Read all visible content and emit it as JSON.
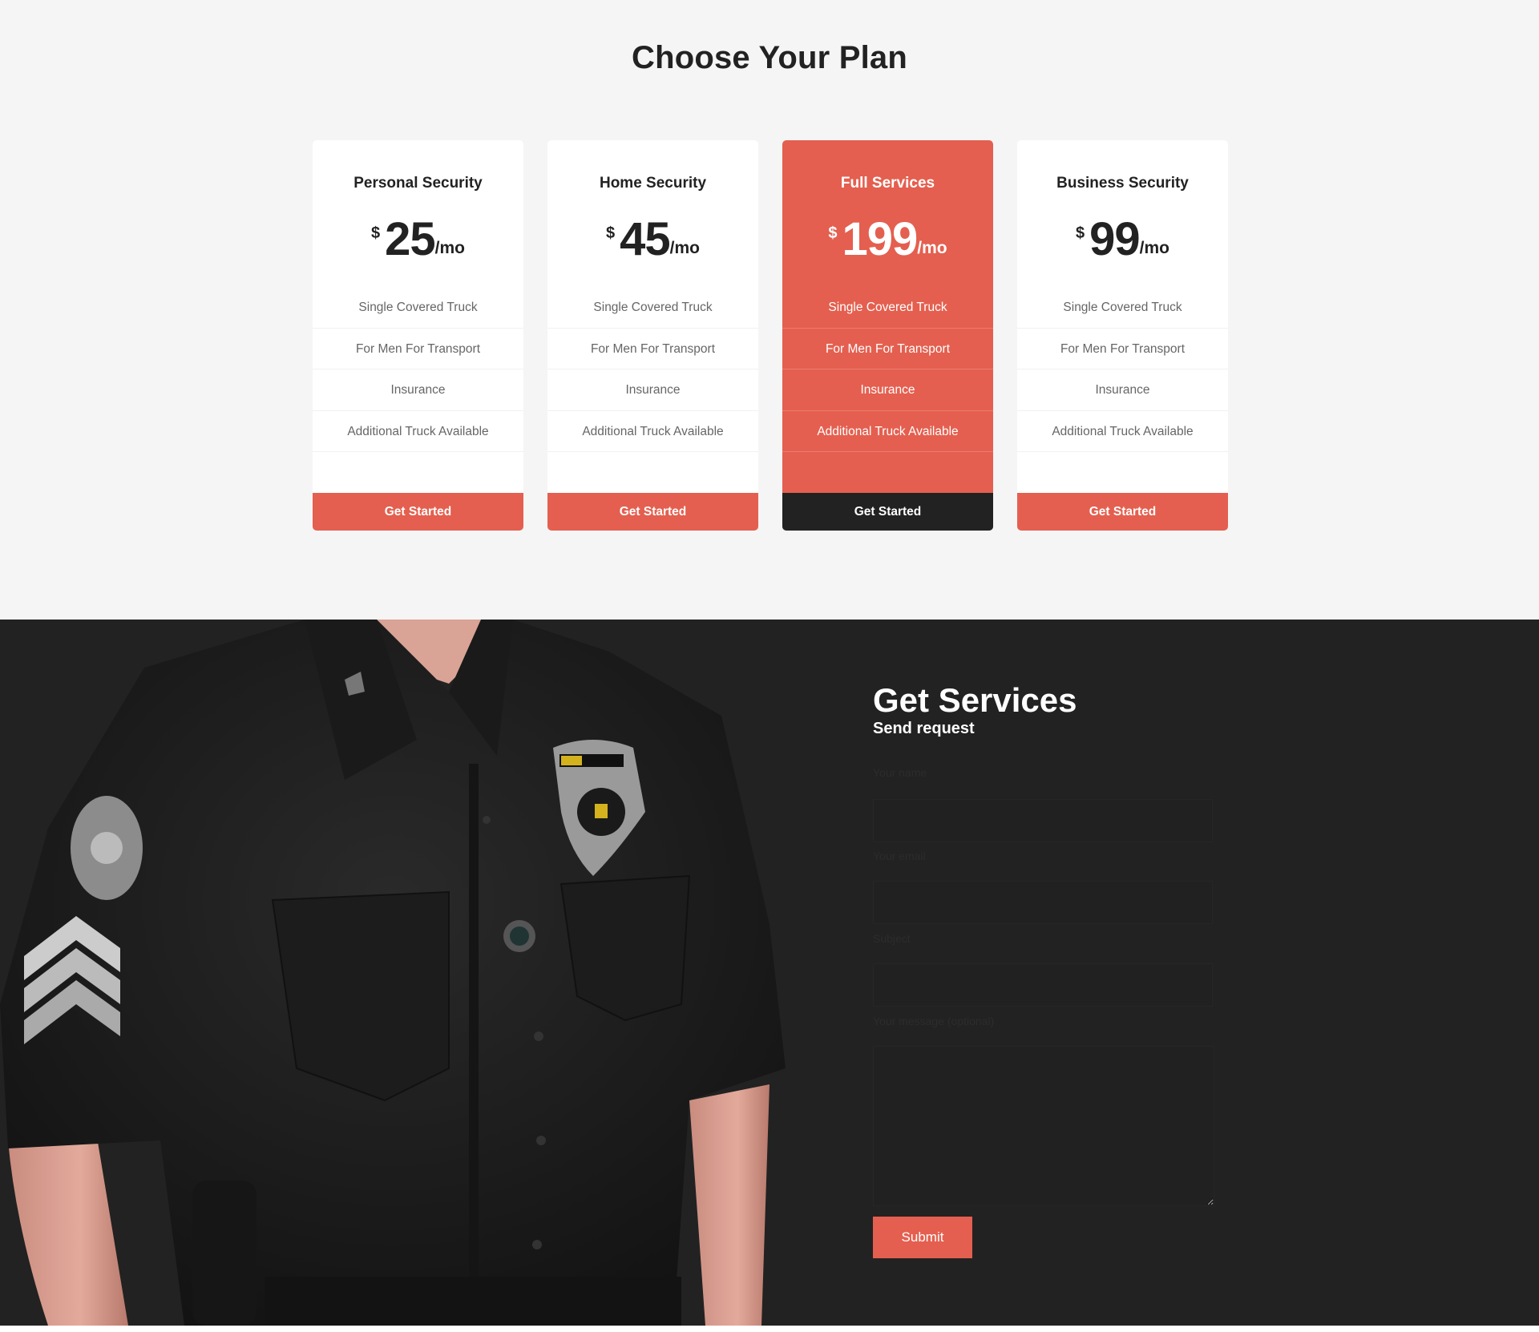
{
  "pricing": {
    "title": "Choose Your Plan",
    "currency_symbol": "$",
    "period": "/mo",
    "plans": [
      {
        "name": "Personal Security",
        "price": "25",
        "featured": false,
        "features": [
          "Single Covered Truck",
          "For Men For Transport",
          "Insurance",
          "Additional Truck Available"
        ],
        "button": "Get Started"
      },
      {
        "name": "Home Security",
        "price": "45",
        "featured": false,
        "features": [
          "Single Covered Truck",
          "For Men For Transport",
          "Insurance",
          "Additional Truck Available"
        ],
        "button": "Get Started"
      },
      {
        "name": "Full Services",
        "price": "199",
        "featured": true,
        "features": [
          "Single Covered Truck",
          "For Men For Transport",
          "Insurance",
          "Additional Truck Available"
        ],
        "button": "Get Started"
      },
      {
        "name": "Business Security",
        "price": "99",
        "featured": false,
        "features": [
          "Single Covered Truck",
          "For Men For Transport",
          "Insurance",
          "Additional Truck Available"
        ],
        "button": "Get Started"
      }
    ]
  },
  "services": {
    "image": "security-officer-uniform-photo",
    "title": "Get Services",
    "subtitle": "Send request",
    "form": {
      "name_label": "Your name",
      "name_value": "",
      "email_label": "Your email",
      "email_value": "",
      "subject_label": "Subject",
      "subject_value": "",
      "message_label": "Your message (optional)",
      "message_value": "",
      "submit_label": "Submit"
    }
  },
  "colors": {
    "accent": "#e45f4f",
    "dark": "#222222",
    "light_bg": "#f5f5f5",
    "text": "#222222",
    "muted_text": "#666666"
  }
}
